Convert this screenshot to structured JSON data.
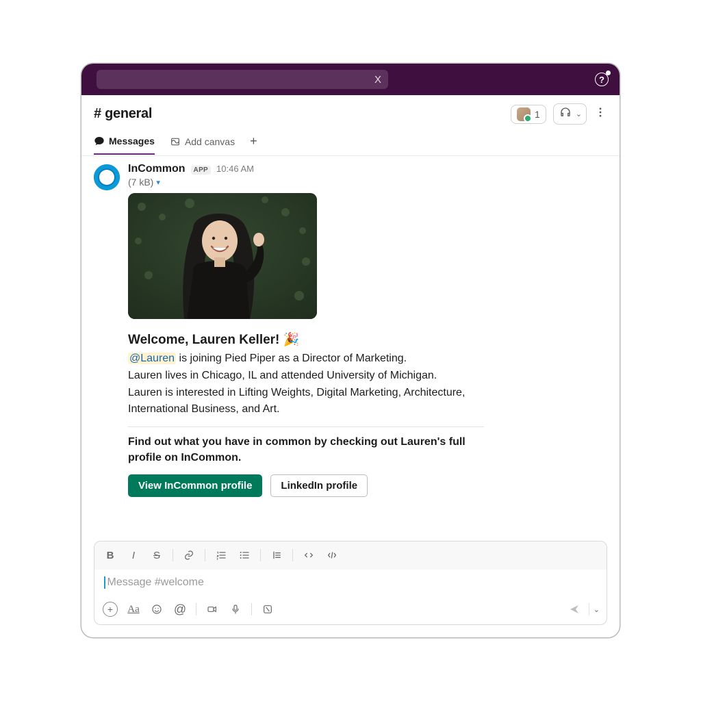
{
  "topbar": {
    "search_close_glyph": "X",
    "help_glyph": "?"
  },
  "channel": {
    "title": "# general",
    "member_count": "1"
  },
  "tabs": {
    "messages": "Messages",
    "add_canvas": "Add canvas",
    "plus": "+"
  },
  "message": {
    "sender": "InCommon",
    "app_badge": "APP",
    "timestamp": "10:46 AM",
    "file_size": "(7 kB)",
    "welcome_heading": "Welcome, Lauren Keller!",
    "tada": "🎉",
    "mention": "@Lauren",
    "line1_rest": " is joining Pied Piper as a Director of Marketing.",
    "line2": "Lauren lives in Chicago, IL and attended University of Michigan.",
    "line3": "Lauren is interested in Lifting Weights, Digital Marketing, Architecture, International Business, and Art.",
    "cta_text": "Find out what you have in common by checking out Lauren's full profile on InCommon.",
    "btn_primary": "View InCommon profile",
    "btn_secondary": "LinkedIn profile"
  },
  "composer": {
    "placeholder": "Message #welcome"
  }
}
